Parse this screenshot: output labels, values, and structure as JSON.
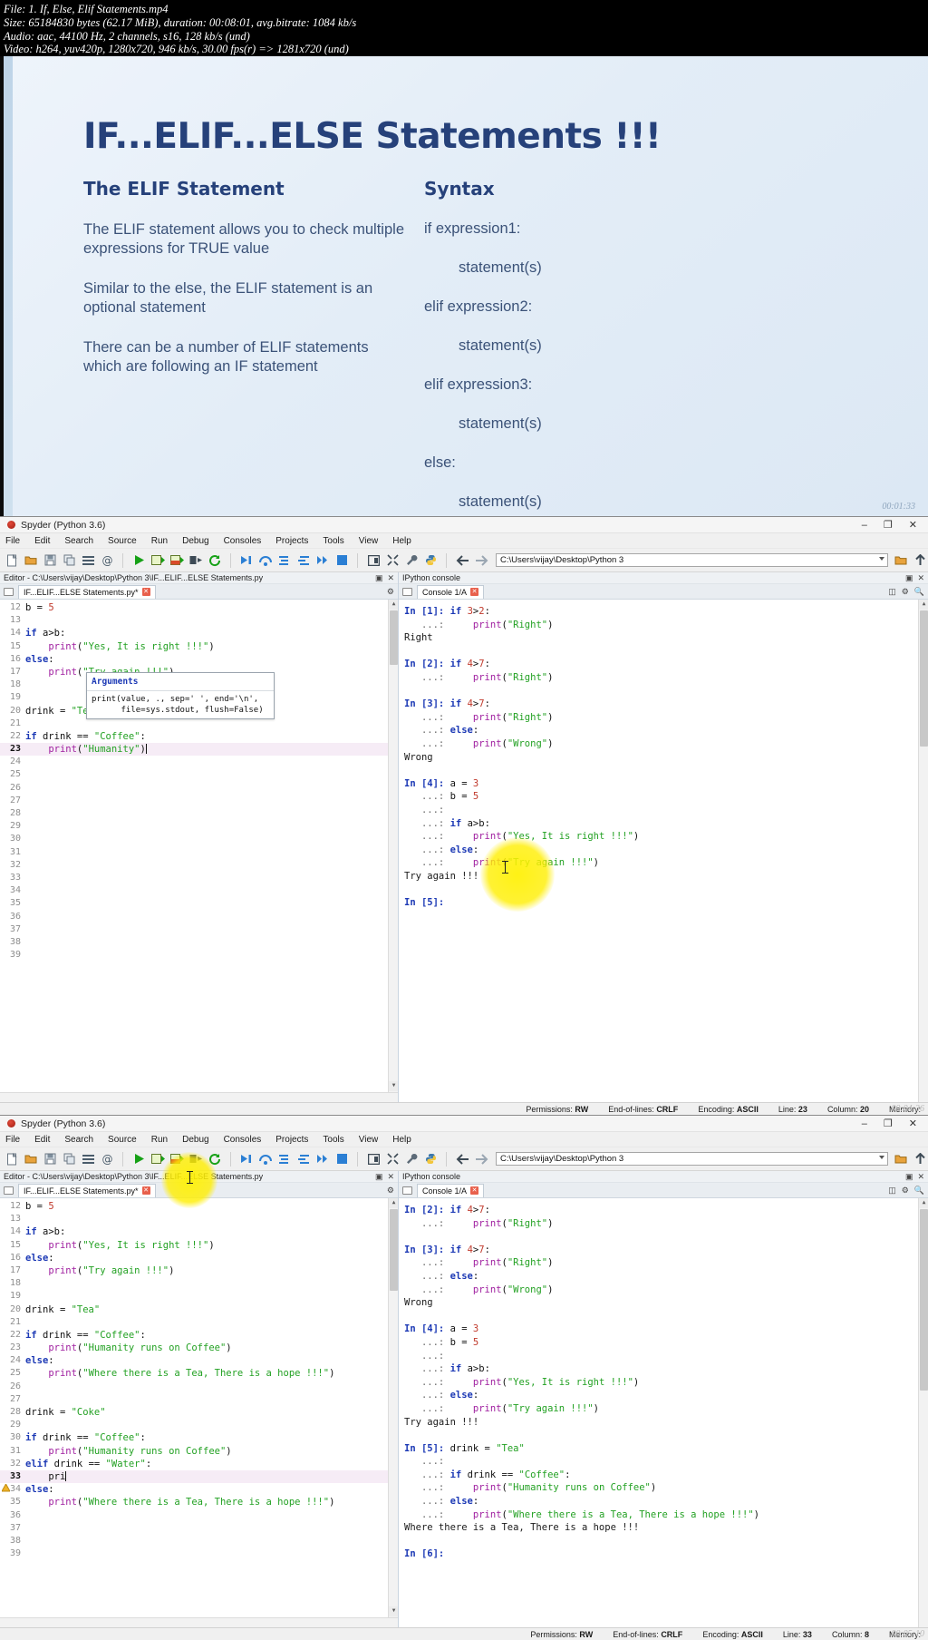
{
  "mediainfo": {
    "line1": "File: 1. If, Else, Elif Statements.mp4",
    "line2": "Size: 65184830 bytes (62.17 MiB), duration: 00:08:01, avg.bitrate: 1084 kb/s",
    "line3": "Audio: aac, 44100 Hz, 2 channels, s16, 128 kb/s (und)",
    "line4": "Video: h264, yuv420p, 1280x720, 946 kb/s, 30.00 fps(r) => 1281x720 (und)"
  },
  "slide": {
    "title": "IF...ELIF...ELSE Statements !!!",
    "left_heading": "The ELIF Statement",
    "left_paragraphs": [
      "The ELIF statement allows you to check multiple expressions for TRUE value",
      "Similar to the else, the ELIF statement is an optional statement",
      "There can be a number of ELIF statements which are following an IF statement"
    ],
    "right_heading": "Syntax",
    "syntax_lines": [
      "if expression1:",
      "statement(s)",
      "elif expression2:",
      "statement(s)",
      "elif expression3:",
      "statement(s)",
      "else:",
      "statement(s)"
    ],
    "timestamp": "00:01:33",
    "title_color": "#26417a",
    "body_color": "#3b5278"
  },
  "window1": {
    "title": "Spyder (Python 3.6)",
    "window_buttons": {
      "minimize": "–",
      "maximize": "❐",
      "close": "✕"
    },
    "menus": [
      "File",
      "Edit",
      "Search",
      "Source",
      "Run",
      "Debug",
      "Consoles",
      "Projects",
      "Tools",
      "View",
      "Help"
    ],
    "path": "C:\\Users\\vijay\\Desktop\\Python 3",
    "editor_header": "Editor - C:\\Users\\vijay\\Desktop\\Python 3\\IF...ELIF...ELSE Statements.py",
    "editor_tab": "IF...ELIF...ELSE Statements.py*",
    "console_header": "IPython console",
    "console_tab": "Console 1/A",
    "editor_lines": [
      {
        "n": "12",
        "text": "b = 5",
        "cur": false
      },
      {
        "n": "13",
        "text": "",
        "cur": false
      },
      {
        "n": "14",
        "text": "if a>b:",
        "cur": false
      },
      {
        "n": "15",
        "text": "    print(\"Yes, It is right !!!\")",
        "cur": false
      },
      {
        "n": "16",
        "text": "else:",
        "cur": false
      },
      {
        "n": "17",
        "text": "    print(\"Try again !!!\")",
        "cur": false
      },
      {
        "n": "18",
        "text": "",
        "cur": false
      },
      {
        "n": "19",
        "text": "",
        "cur": false
      },
      {
        "n": "20",
        "text": "drink = \"Tea\"",
        "cur": false
      },
      {
        "n": "21",
        "text": "",
        "cur": false
      },
      {
        "n": "22",
        "text": "if drink == \"Coffee\":",
        "cur": false
      },
      {
        "n": "23",
        "text": "    print(\"Humanity\")",
        "cur": true
      },
      {
        "n": "24",
        "text": "",
        "cur": false
      },
      {
        "n": "25",
        "text": "",
        "cur": false
      },
      {
        "n": "26",
        "text": "",
        "cur": false
      },
      {
        "n": "27",
        "text": "",
        "cur": false
      },
      {
        "n": "28",
        "text": "",
        "cur": false
      },
      {
        "n": "29",
        "text": "",
        "cur": false
      },
      {
        "n": "30",
        "text": "",
        "cur": false
      },
      {
        "n": "31",
        "text": "",
        "cur": false
      },
      {
        "n": "32",
        "text": "",
        "cur": false
      },
      {
        "n": "33",
        "text": "",
        "cur": false
      },
      {
        "n": "34",
        "text": "",
        "cur": false
      },
      {
        "n": "35",
        "text": "",
        "cur": false
      },
      {
        "n": "36",
        "text": "",
        "cur": false
      },
      {
        "n": "37",
        "text": "",
        "cur": false
      },
      {
        "n": "38",
        "text": "",
        "cur": false
      },
      {
        "n": "39",
        "text": "",
        "cur": false
      }
    ],
    "tooltip": {
      "heading": "Arguments",
      "body": "print(value, ., sep=' ', end='\\n',\n      file=sys.stdout, flush=False)"
    },
    "console_lines": [
      "In [1]: if 3>2:",
      "   ...:     print(\"Right\")",
      "Right",
      "",
      "In [2]: if 4>7:",
      "   ...:     print(\"Right\")",
      "",
      "In [3]: if 4>7:",
      "   ...:     print(\"Right\")",
      "   ...: else:",
      "   ...:     print(\"Wrong\")",
      "Wrong",
      "",
      "In [4]: a = 3",
      "   ...: b = 5",
      "   ...:",
      "   ...: if a>b:",
      "   ...:     print(\"Yes, It is right !!!\")",
      "   ...: else:",
      "   ...:     print(\"Try again !!!\")",
      "Try again !!!",
      "",
      "In [5]:"
    ],
    "status": {
      "permissions_label": "Permissions:",
      "permissions": "RW",
      "eol_label": "End-of-lines:",
      "eol": "CRLF",
      "encoding_label": "Encoding:",
      "encoding": "ASCII",
      "line_label": "Line:",
      "line": "23",
      "column_label": "Column:",
      "column": "20",
      "memory_label": "Memory:"
    },
    "timestamp": "00:04:36"
  },
  "window2": {
    "title": "Spyder (Python 3.6)",
    "window_buttons": {
      "minimize": "–",
      "maximize": "❐",
      "close": "✕"
    },
    "menus": [
      "File",
      "Edit",
      "Search",
      "Source",
      "Run",
      "Debug",
      "Consoles",
      "Projects",
      "Tools",
      "View",
      "Help"
    ],
    "path": "C:\\Users\\vijay\\Desktop\\Python 3",
    "editor_header": "Editor - C:\\Users\\vijay\\Desktop\\Python 3\\IF...ELIF...ELSE Statements.py",
    "editor_tab": "IF...ELIF...ELSE Statements.py*",
    "console_header": "IPython console",
    "console_tab": "Console 1/A",
    "editor_lines": [
      {
        "n": "12",
        "text": "b = 5",
        "cur": false,
        "warn": false
      },
      {
        "n": "13",
        "text": "",
        "cur": false,
        "warn": false
      },
      {
        "n": "14",
        "text": "if a>b:",
        "cur": false,
        "warn": false
      },
      {
        "n": "15",
        "text": "    print(\"Yes, It is right !!!\")",
        "cur": false,
        "warn": false
      },
      {
        "n": "16",
        "text": "else:",
        "cur": false,
        "warn": false
      },
      {
        "n": "17",
        "text": "    print(\"Try again !!!\")",
        "cur": false,
        "warn": false
      },
      {
        "n": "18",
        "text": "",
        "cur": false,
        "warn": false
      },
      {
        "n": "19",
        "text": "",
        "cur": false,
        "warn": false
      },
      {
        "n": "20",
        "text": "drink = \"Tea\"",
        "cur": false,
        "warn": false
      },
      {
        "n": "21",
        "text": "",
        "cur": false,
        "warn": false
      },
      {
        "n": "22",
        "text": "if drink == \"Coffee\":",
        "cur": false,
        "warn": false
      },
      {
        "n": "23",
        "text": "    print(\"Humanity runs on Coffee\")",
        "cur": false,
        "warn": false
      },
      {
        "n": "24",
        "text": "else:",
        "cur": false,
        "warn": false
      },
      {
        "n": "25",
        "text": "    print(\"Where there is a Tea, There is a hope !!!\")",
        "cur": false,
        "warn": false
      },
      {
        "n": "26",
        "text": "",
        "cur": false,
        "warn": false
      },
      {
        "n": "27",
        "text": "",
        "cur": false,
        "warn": false
      },
      {
        "n": "28",
        "text": "drink = \"Coke\"",
        "cur": false,
        "warn": false
      },
      {
        "n": "29",
        "text": "",
        "cur": false,
        "warn": false
      },
      {
        "n": "30",
        "text": "if drink == \"Coffee\":",
        "cur": false,
        "warn": false
      },
      {
        "n": "31",
        "text": "    print(\"Humanity runs on Coffee\")",
        "cur": false,
        "warn": false
      },
      {
        "n": "32",
        "text": "elif drink == \"Water\":",
        "cur": false,
        "warn": false
      },
      {
        "n": "33",
        "text": "    pri",
        "cur": true,
        "warn": false
      },
      {
        "n": "34",
        "text": "else:",
        "cur": false,
        "warn": true
      },
      {
        "n": "35",
        "text": "    print(\"Where there is a Tea, There is a hope !!!\")",
        "cur": false,
        "warn": false
      },
      {
        "n": "36",
        "text": "",
        "cur": false,
        "warn": false
      },
      {
        "n": "37",
        "text": "",
        "cur": false,
        "warn": false
      },
      {
        "n": "38",
        "text": "",
        "cur": false,
        "warn": false
      },
      {
        "n": "39",
        "text": "",
        "cur": false,
        "warn": false
      }
    ],
    "console_lines": [
      "In [2]: if 4>7:",
      "   ...:     print(\"Right\")",
      "",
      "In [3]: if 4>7:",
      "   ...:     print(\"Right\")",
      "   ...: else:",
      "   ...:     print(\"Wrong\")",
      "Wrong",
      "",
      "In [4]: a = 3",
      "   ...: b = 5",
      "   ...:",
      "   ...: if a>b:",
      "   ...:     print(\"Yes, It is right !!!\")",
      "   ...: else:",
      "   ...:     print(\"Try again !!!\")",
      "Try again !!!",
      "",
      "In [5]: drink = \"Tea\"",
      "   ...:",
      "   ...: if drink == \"Coffee\":",
      "   ...:     print(\"Humanity runs on Coffee\")",
      "   ...: else:",
      "   ...:     print(\"Where there is a Tea, There is a hope !!!\")",
      "Where there is a Tea, There is a hope !!!",
      "",
      "In [6]:"
    ],
    "status": {
      "permissions_label": "Permissions:",
      "permissions": "RW",
      "eol_label": "End-of-lines:",
      "eol": "CRLF",
      "encoding_label": "Encoding:",
      "encoding": "ASCII",
      "line_label": "Line:",
      "line": "33",
      "column_label": "Column:",
      "column": "8",
      "memory_label": "Memory:"
    },
    "timestamp": "00:05:10"
  },
  "icons": {
    "new_file": "new-file-icon",
    "open_file": "open-folder-icon",
    "save_file": "save-icon",
    "save_all": "save-all-icon",
    "list": "list-icon",
    "at": "at-icon",
    "run": "run-icon",
    "run_cell": "run-cell-icon",
    "run_cell_advance": "run-cell-advance-icon",
    "run_selection": "run-selection-icon",
    "rerun": "rerun-icon",
    "debug": "debug-icon",
    "step_over": "step-over-icon",
    "step_into": "step-into-icon",
    "step_return": "step-return-icon",
    "continue": "continue-icon",
    "stop": "stop-icon",
    "maximize_pane": "maximize-pane-icon",
    "fullscreen": "fullscreen-icon",
    "preferences": "wrench-icon",
    "python_path": "python-icon",
    "back": "arrow-left-icon",
    "forward": "arrow-right-icon",
    "browse": "browse-folder-icon",
    "parent": "arrow-up-icon"
  }
}
